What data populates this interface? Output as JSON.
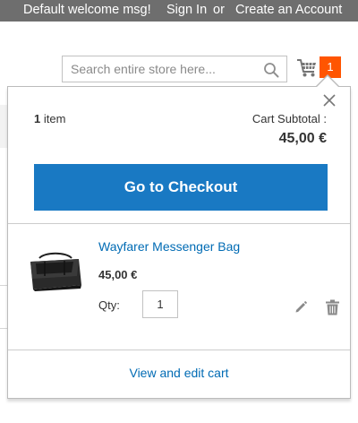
{
  "topbar": {
    "welcome": "Default welcome msg!",
    "sign_in": "Sign In",
    "or": "or",
    "create_account": "Create an Account"
  },
  "search": {
    "placeholder": "Search entire store here...",
    "icon": "search-icon"
  },
  "cart": {
    "icon": "shopping-cart-icon",
    "count": "1"
  },
  "minicart": {
    "item_count_number": "1",
    "item_count_label": "item",
    "subtotal_label": "Cart Subtotal :",
    "subtotal_value": "45,00 €",
    "checkout_label": "Go to Checkout",
    "items": [
      {
        "name": "Wayfarer Messenger Bag",
        "price": "45,00 €",
        "qty_label": "Qty:",
        "qty": "1"
      }
    ],
    "view_edit_label": "View and edit cart"
  },
  "colors": {
    "topbar": "#6e6e6e",
    "primary_button": "#1979c3",
    "link": "#006bb4",
    "badge": "#ff5501"
  }
}
